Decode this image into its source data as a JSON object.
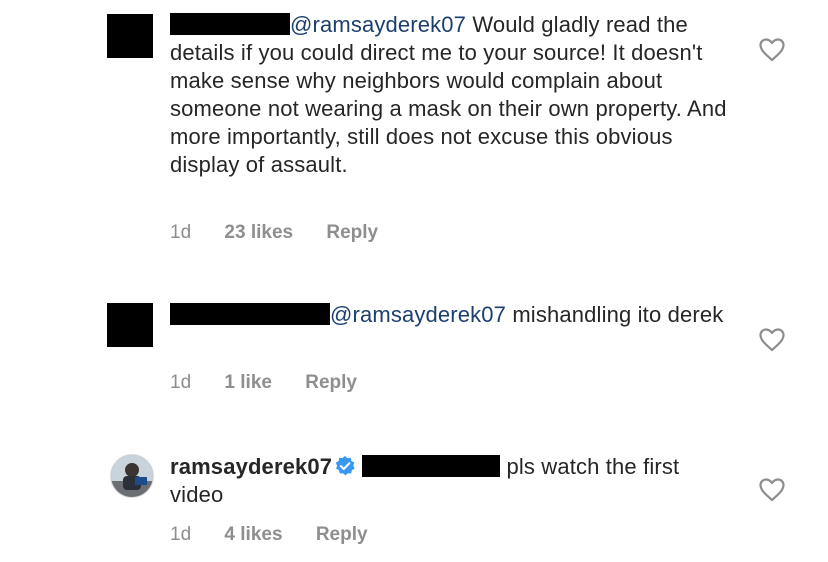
{
  "comments": [
    {
      "mention": "@ramsayderek07",
      "text": " Would gladly read the details if you could direct me to your source! It doesn't make sense why neighbors would complain about someone not wearing a mask on their own property. And more importantly, still does not excuse this obvious display of assault.",
      "time": "1d",
      "likes": "23 likes",
      "reply": "Reply",
      "heart_icon": "heart-outline-icon"
    },
    {
      "mention": "@ramsayderek07",
      "text": " mishandling ito derek",
      "time": "1d",
      "likes": "1 like",
      "reply": "Reply",
      "heart_icon": "heart-outline-icon"
    },
    {
      "username": "ramsayderek07",
      "text": " pls watch the first video",
      "time": "1d",
      "likes": "4 likes",
      "reply": "Reply",
      "verified_icon": "verified-badge-icon",
      "heart_icon": "heart-outline-icon"
    }
  ],
  "colors": {
    "mention": "#1c3f6e",
    "meta": "#8e8e8e",
    "verified": "#3897f0",
    "redaction": "#000000"
  }
}
